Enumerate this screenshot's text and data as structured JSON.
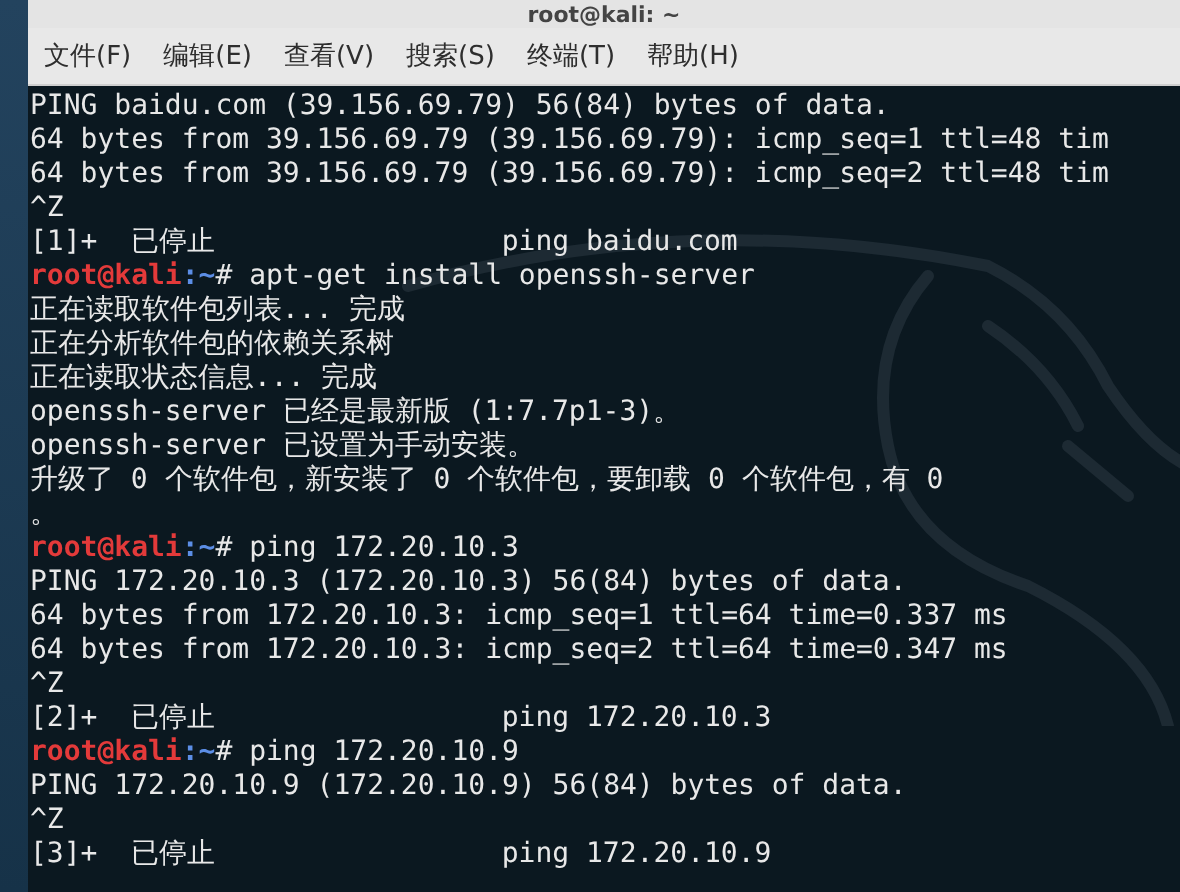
{
  "window": {
    "title": "root@kali: ~"
  },
  "menu": [
    "文件(F)",
    "编辑(E)",
    "查看(V)",
    "搜索(S)",
    "终端(T)",
    "帮助(H)"
  ],
  "terminal": {
    "lines": [
      {
        "kind": "output",
        "text": "PING baidu.com (39.156.69.79) 56(84) bytes of data."
      },
      {
        "kind": "output",
        "text": "64 bytes from 39.156.69.79 (39.156.69.79): icmp_seq=1 ttl=48 tim"
      },
      {
        "kind": "output",
        "text": "64 bytes from 39.156.69.79 (39.156.69.79): icmp_seq=2 ttl=48 tim"
      },
      {
        "kind": "output",
        "text": "^Z"
      },
      {
        "kind": "output",
        "text": "[1]+  已停止                 ping baidu.com"
      },
      {
        "kind": "prompt",
        "user": "root@kali",
        "path": ":~",
        "command": "# apt-get install openssh-server"
      },
      {
        "kind": "output",
        "text": "正在读取软件包列表... 完成"
      },
      {
        "kind": "output",
        "text": "正在分析软件包的依赖关系树"
      },
      {
        "kind": "output",
        "text": "正在读取状态信息... 完成"
      },
      {
        "kind": "output",
        "text": "openssh-server 已经是最新版 (1:7.7p1-3)。"
      },
      {
        "kind": "output",
        "text": "openssh-server 已设置为手动安装。"
      },
      {
        "kind": "output",
        "text": "升级了 0 个软件包，新安装了 0 个软件包，要卸载 0 个软件包，有 0"
      },
      {
        "kind": "output",
        "text": "。"
      },
      {
        "kind": "prompt",
        "user": "root@kali",
        "path": ":~",
        "command": "# ping 172.20.10.3"
      },
      {
        "kind": "output",
        "text": "PING 172.20.10.3 (172.20.10.3) 56(84) bytes of data."
      },
      {
        "kind": "output",
        "text": "64 bytes from 172.20.10.3: icmp_seq=1 ttl=64 time=0.337 ms"
      },
      {
        "kind": "output",
        "text": "64 bytes from 172.20.10.3: icmp_seq=2 ttl=64 time=0.347 ms"
      },
      {
        "kind": "output",
        "text": "^Z"
      },
      {
        "kind": "output",
        "text": "[2]+  已停止                 ping 172.20.10.3"
      },
      {
        "kind": "prompt",
        "user": "root@kali",
        "path": ":~",
        "command": "# ping 172.20.10.9"
      },
      {
        "kind": "output",
        "text": "PING 172.20.10.9 (172.20.10.9) 56(84) bytes of data."
      },
      {
        "kind": "output",
        "text": "^Z"
      },
      {
        "kind": "output",
        "text": "[3]+  已停止                 ping 172.20.10.9"
      }
    ]
  }
}
